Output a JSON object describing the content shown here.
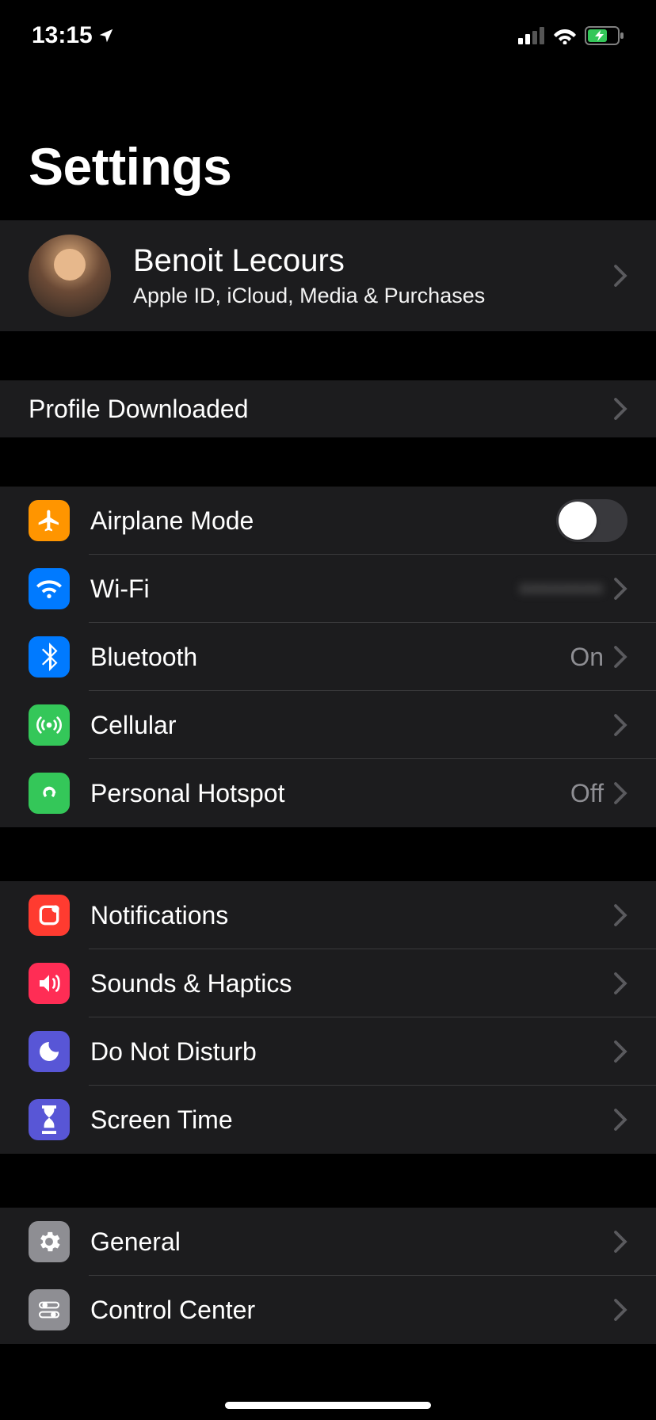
{
  "status": {
    "time": "13:15"
  },
  "title": "Settings",
  "profile": {
    "name": "Benoit Lecours",
    "subtitle": "Apple ID, iCloud, Media & Purchases"
  },
  "alert": {
    "label": "Profile Downloaded"
  },
  "groups": [
    {
      "items": [
        {
          "key": "airplane",
          "label": "Airplane Mode",
          "type": "toggle",
          "toggle": false,
          "color": "#ff9500"
        },
        {
          "key": "wifi",
          "label": "Wi-Fi",
          "type": "chevron",
          "value": "••••••••",
          "blur": true,
          "color": "#007aff"
        },
        {
          "key": "bluetooth",
          "label": "Bluetooth",
          "type": "chevron",
          "value": "On",
          "color": "#007aff"
        },
        {
          "key": "cellular",
          "label": "Cellular",
          "type": "chevron",
          "color": "#34c759"
        },
        {
          "key": "hotspot",
          "label": "Personal Hotspot",
          "type": "chevron",
          "value": "Off",
          "color": "#34c759"
        }
      ]
    },
    {
      "items": [
        {
          "key": "notifications",
          "label": "Notifications",
          "type": "chevron",
          "color": "#ff3b30"
        },
        {
          "key": "sounds",
          "label": "Sounds & Haptics",
          "type": "chevron",
          "color": "#ff2d55"
        },
        {
          "key": "dnd",
          "label": "Do Not Disturb",
          "type": "chevron",
          "color": "#5856d6"
        },
        {
          "key": "screentime",
          "label": "Screen Time",
          "type": "chevron",
          "color": "#5856d6"
        }
      ]
    },
    {
      "items": [
        {
          "key": "general",
          "label": "General",
          "type": "chevron",
          "color": "#8e8e93"
        },
        {
          "key": "controlcenter",
          "label": "Control Center",
          "type": "chevron",
          "color": "#8e8e93"
        }
      ]
    }
  ]
}
